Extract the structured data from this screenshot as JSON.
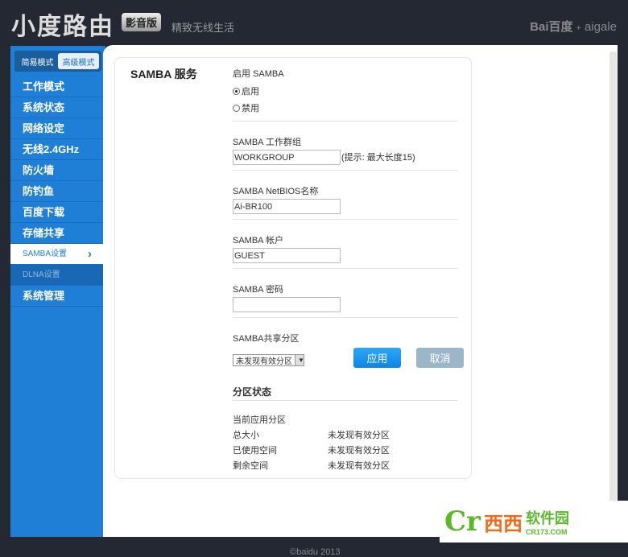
{
  "header": {
    "logo": "小度路由",
    "badge": "影音版",
    "slogan": "精致无线生活",
    "brand_baidu": "Bai百度",
    "brand_plus": "+",
    "brand_aigale": "aigale"
  },
  "modes": {
    "simple": "简易模式",
    "advanced": "高级模式"
  },
  "sidebar": {
    "items": [
      {
        "label": "工作模式"
      },
      {
        "label": "系统状态"
      },
      {
        "label": "网络设定"
      },
      {
        "label": "无线2.4GHz"
      },
      {
        "label": "防火墙"
      },
      {
        "label": "防钓鱼"
      },
      {
        "label": "百度下载"
      },
      {
        "label": "存储共享"
      },
      {
        "label": "SAMBA设置",
        "chevron": "›"
      },
      {
        "label": "DLNA设置"
      },
      {
        "label": "系统管理"
      }
    ]
  },
  "page": {
    "title": "SAMBA 服务",
    "enable_label": "启用 SAMBA",
    "enable_on": "启用",
    "enable_off": "禁用",
    "workgroup_label": "SAMBA 工作群组",
    "workgroup_value": "WORKGROUP",
    "workgroup_hint": "(提示: 最大长度15)",
    "netbios_label": "SAMBA NetBIOS名称",
    "netbios_value": "Ai-BR100",
    "account_label": "SAMBA 帐户",
    "account_value": "GUEST",
    "password_label": "SAMBA 密码",
    "password_value": "",
    "share_label": "SAMBA共享分区",
    "share_selected": "未发现有效分区",
    "apply": "应用",
    "cancel": "取消"
  },
  "status": {
    "title": "分区状态",
    "current_label": "当前应用分区",
    "rows": [
      {
        "k": "总大小",
        "v": "未发现有效分区"
      },
      {
        "k": "已使用空间",
        "v": "未发现有效分区"
      },
      {
        "k": "剩余空间",
        "v": "未发现有效分区"
      }
    ]
  },
  "footer": "©baidu 2013",
  "watermark": {
    "cr": "Cr",
    "xx": "西西",
    "rj": "软件园",
    "domain": "CR173.COM"
  }
}
